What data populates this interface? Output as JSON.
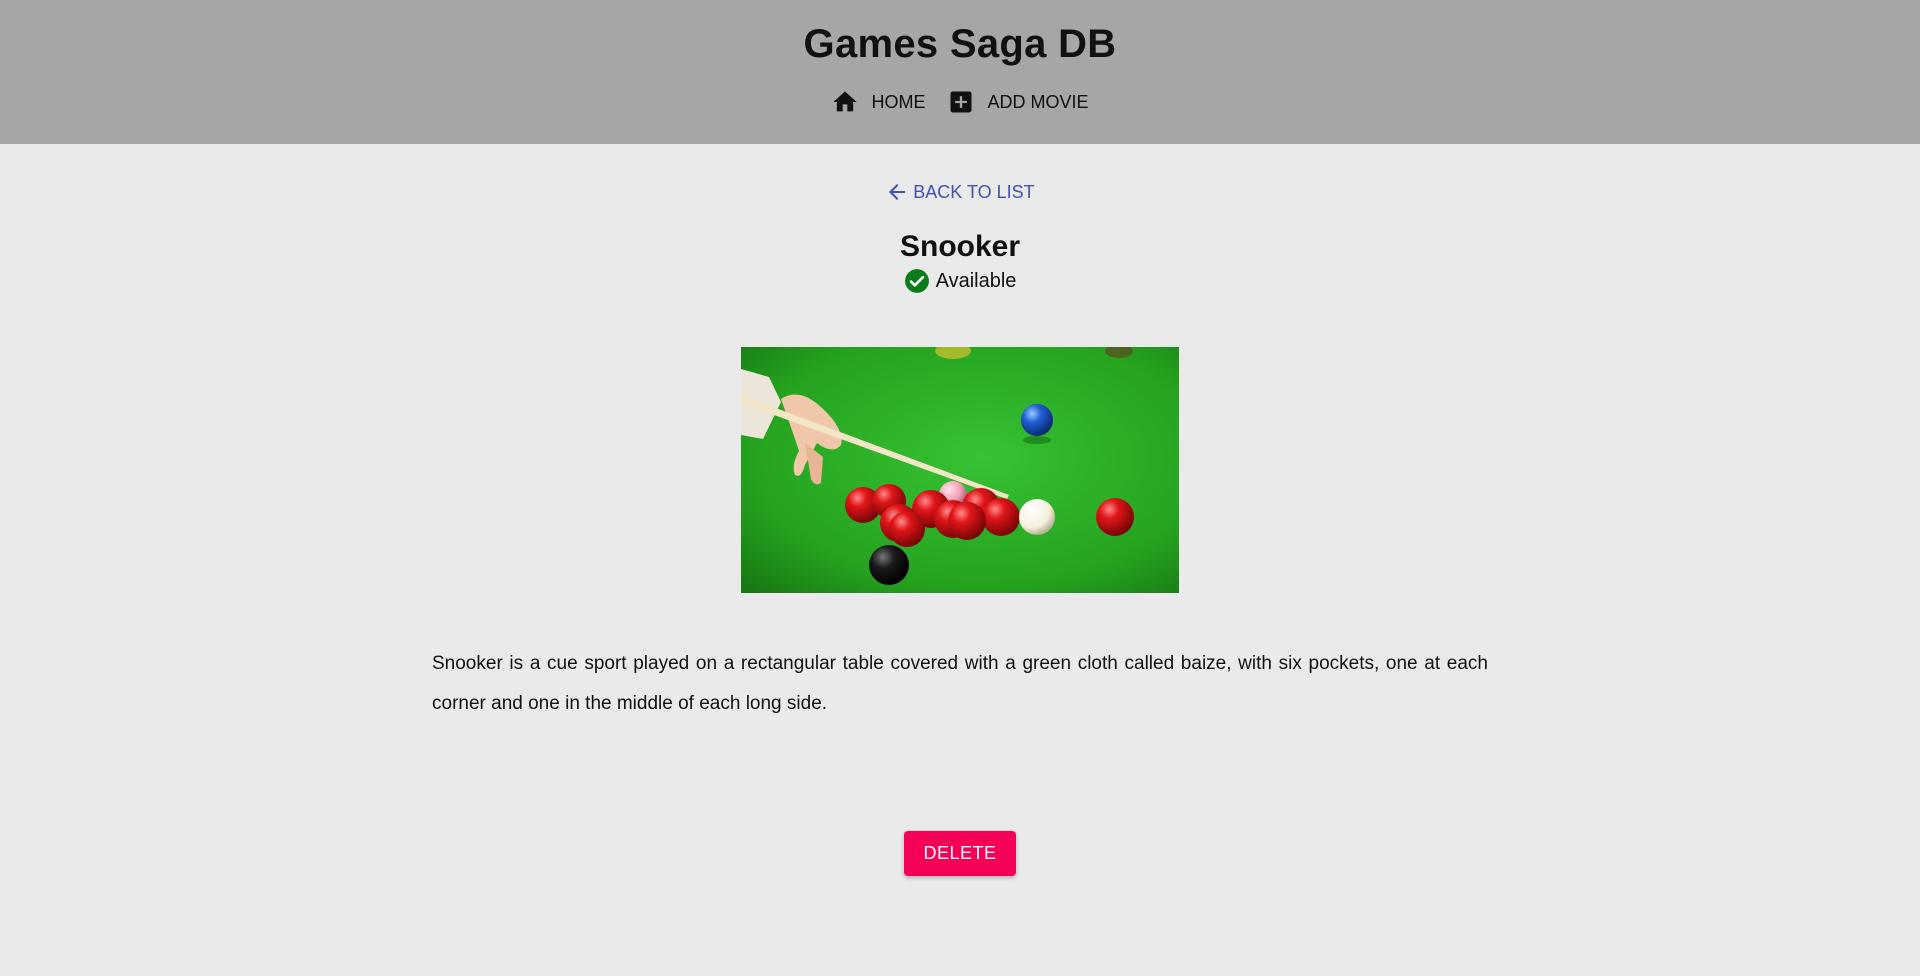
{
  "header": {
    "title": "Games Saga DB",
    "nav": [
      {
        "label": "HOME",
        "icon": "home-icon"
      },
      {
        "label": "ADD MOVIE",
        "icon": "add-box-icon"
      }
    ],
    "background": "#a6a6a6"
  },
  "detail": {
    "back_label": "BACK TO LIST",
    "back_icon": "arrow-left-icon",
    "title": "Snooker",
    "status": {
      "label": "Available",
      "icon": "check-circle-icon",
      "color": "#0a7d1a"
    },
    "image": {
      "subject": "snooker-table-photo"
    },
    "description": "Snooker is a cue sport played on a rectangular table covered with a green cloth called baize, with six pockets, one at each corner and one in the middle of each long side.",
    "delete_label": "DELETE"
  },
  "colors": {
    "accent_link": "#3f51b5",
    "delete": "#f50057",
    "page_background": "#eaeaea"
  }
}
